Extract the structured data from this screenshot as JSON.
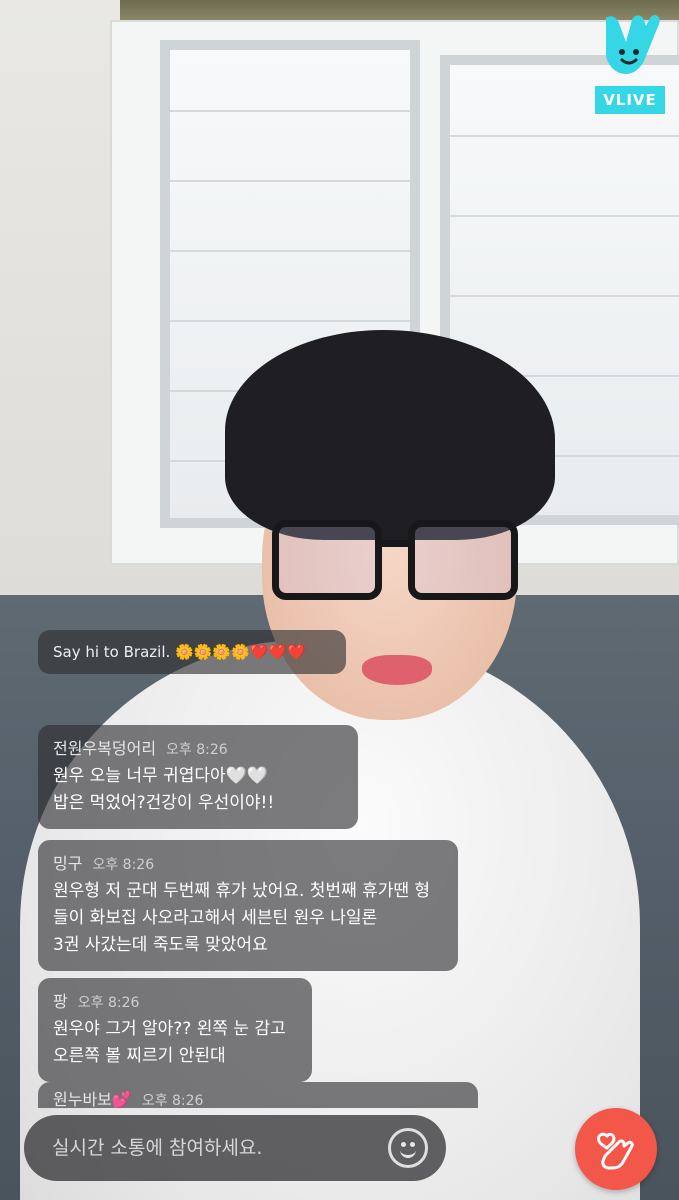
{
  "brand": {
    "name": "VLIVE",
    "accent": "#35d7e6"
  },
  "chat": {
    "messages": [
      {
        "user": "",
        "time": "",
        "text": "Say hi to Brazil. 🌼🌼🌼🌼❤️❤️❤️"
      },
      {
        "user": "전원우복덩어리",
        "time": "오후 8:26",
        "text": "원우 오늘 너무 귀엽다아🤍🤍\n밥은 먹었어?건강이 우선이야!!"
      },
      {
        "user": "밍구",
        "time": "오후 8:26",
        "text": "원우형 저 군대 두번째 휴가 났어요. 첫번째 휴가땐 형\n들이 화보집 사오라고해서 세븐틴 원우 나일론\n3권 사갔는데 죽도록 맞았어요"
      },
      {
        "user": "팡",
        "time": "오후 8:26",
        "text": "원우야 그거 알아?? 왼쪽 눈 감고\n오른쪽 볼 찌르기 안된대"
      },
      {
        "user": "원누바보💕",
        "time": "오후 8:26",
        "text": ""
      }
    ]
  },
  "input": {
    "placeholder": "실시간 소통에 참여하세요.",
    "value": ""
  },
  "icons": {
    "emoji": "smile-icon",
    "like": "finger-heart-icon",
    "logo": "vlive-v-icon"
  },
  "colors": {
    "like_button": "#f2574a",
    "bubble": "rgba(45,45,48,.62)"
  }
}
